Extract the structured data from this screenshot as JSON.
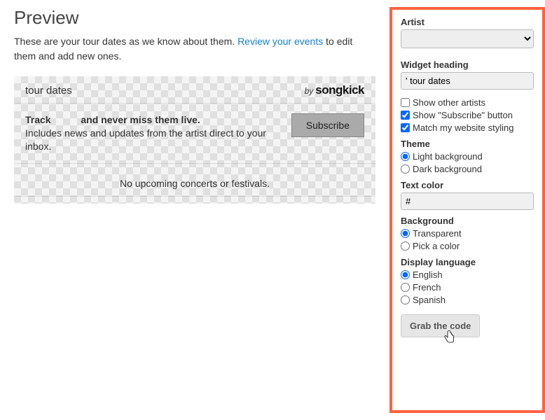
{
  "preview": {
    "title": "Preview",
    "desc_before": "These are your tour dates as we know about them. ",
    "review_link": "Review your events",
    "desc_after": " to edit them and add new ones."
  },
  "widget": {
    "title": "tour dates",
    "by": "by",
    "brand": "songkick",
    "track_bold_prefix": "Track",
    "track_bold_suffix": "and never miss them live.",
    "track_desc": "Includes news and updates from the artist direct to your inbox.",
    "subscribe": "Subscribe",
    "no_upcoming": "No upcoming concerts or festivals."
  },
  "sidebar": {
    "artist_label": "Artist",
    "artist_value": "",
    "heading_label": "Widget heading",
    "heading_value": "' tour dates",
    "show_other_artists": "Show other artists",
    "show_subscribe": "Show \"Subscribe\" button",
    "match_styling": "Match my website styling",
    "theme_label": "Theme",
    "theme_light": "Light background",
    "theme_dark": "Dark background",
    "text_color_label": "Text color",
    "text_color_value": "#",
    "background_label": "Background",
    "bg_transparent": "Transparent",
    "bg_pick": "Pick a color",
    "language_label": "Display language",
    "lang_en": "English",
    "lang_fr": "French",
    "lang_es": "Spanish",
    "grab": "Grab the code"
  },
  "state": {
    "show_other_artists": false,
    "show_subscribe": true,
    "match_styling": true,
    "theme": "light",
    "background": "transparent",
    "language": "en"
  }
}
